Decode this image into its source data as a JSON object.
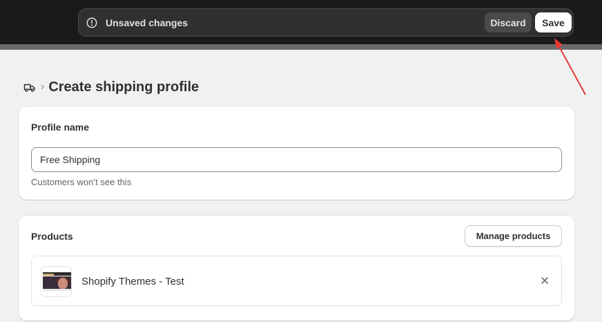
{
  "save_bar": {
    "message": "Unsaved changes",
    "discard_label": "Discard",
    "save_label": "Save"
  },
  "breadcrumb": {
    "icon": "truck-icon",
    "title": "Create shipping profile"
  },
  "profile_card": {
    "title": "Profile name",
    "input_value": "Free Shipping",
    "help_text": "Customers won’t see this"
  },
  "products_card": {
    "title": "Products",
    "manage_label": "Manage products",
    "items": [
      {
        "name": "Shopify Themes - Test"
      }
    ]
  },
  "colors": {
    "topbar": "#1a1a1a",
    "save_bar": "#303030",
    "annotation_arrow": "#e53935"
  }
}
